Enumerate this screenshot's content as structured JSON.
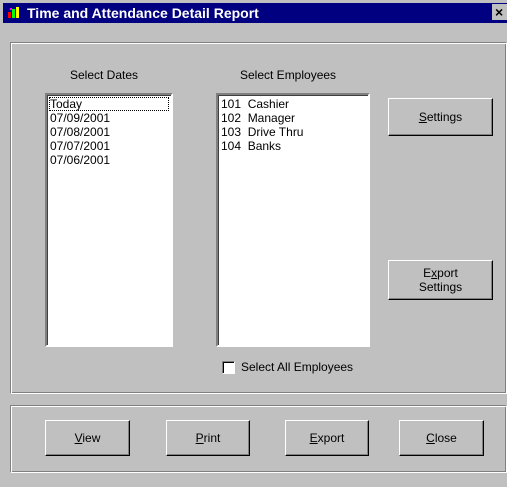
{
  "window": {
    "title": "Time and Attendance Detail Report",
    "close_glyph": "×"
  },
  "dates": {
    "label": "Select Dates",
    "items": [
      "Today",
      "07/09/2001",
      "07/08/2001",
      "07/07/2001",
      "07/06/2001"
    ],
    "focused_item": "Today"
  },
  "employees": {
    "label": "Select Employees",
    "items": [
      "101  Cashier",
      "102  Manager",
      "103  Drive Thru",
      "104  Banks"
    ],
    "select_all_label": "Select All Employees",
    "select_all_checked": false
  },
  "buttons": {
    "settings": {
      "mnemonic": "S",
      "rest": "ettings"
    },
    "export_settings": {
      "pre": "E",
      "mnemonic": "x",
      "rest": "port",
      "line2": "Settings"
    },
    "view": {
      "mnemonic": "V",
      "rest": "iew"
    },
    "print": {
      "mnemonic": "P",
      "rest": "rint"
    },
    "export": {
      "mnemonic": "E",
      "rest": "xport"
    },
    "close": {
      "mnemonic": "C",
      "rest": "lose"
    }
  },
  "colors": {
    "titlebar": "#000080",
    "face": "#c0c0c0",
    "list_bg": "#ffffff"
  },
  "icons": {
    "app_icon": "app-icon",
    "close_icon": "close-icon"
  }
}
